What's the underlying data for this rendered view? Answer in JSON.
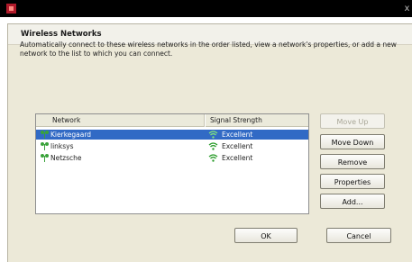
{
  "window": {
    "close_glyph": "x"
  },
  "dialog": {
    "title": "Wireless Networks",
    "description": "Automatically connect to these wireless networks in the order listed, view a network's properties, or add a new network to the list to which you can connect."
  },
  "list": {
    "columns": {
      "network": "Network",
      "signal": "Signal Strength"
    },
    "rows": [
      {
        "name": "Kierkegaard",
        "signal": "Excellent",
        "selected": true
      },
      {
        "name": "linksys",
        "signal": "Excellent",
        "selected": false
      },
      {
        "name": "Netzsche",
        "signal": "Excellent",
        "selected": false
      }
    ]
  },
  "buttons": {
    "move_up": "Move Up",
    "move_down": "Move Down",
    "remove": "Remove",
    "properties": "Properties",
    "add": "Add...",
    "ok": "OK",
    "cancel": "Cancel"
  },
  "colors": {
    "selection": "#316ac5",
    "signal_icon": "#2e9e2e"
  },
  "icons": {
    "title": "network-wizard-icon",
    "network": "wireless-network-icon",
    "signal": "signal-strength-icon"
  }
}
